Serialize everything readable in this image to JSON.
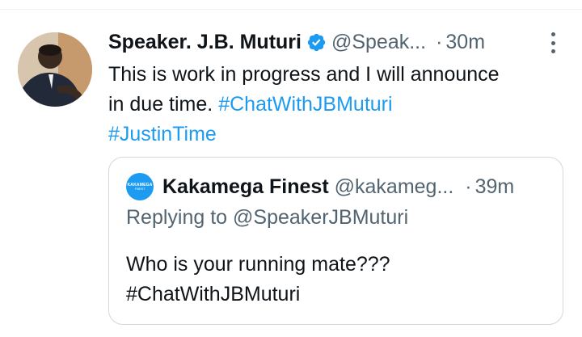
{
  "tweet": {
    "author_name": "Speaker. J.B. Muturi",
    "handle": "@Speak...",
    "separator": "·",
    "time": "30m",
    "text_lines": [
      "This is work in progress and I will announce",
      "in due time."
    ],
    "hashtags": [
      "#ChatWithJBMuturi",
      "#JustinTime"
    ]
  },
  "quoted_tweet": {
    "avatar_text_1": "KAKAMEGA",
    "avatar_text_2": "FINEST",
    "author_name": "Kakamega Finest",
    "handle": "@kakameg...",
    "separator": "·",
    "time": "39m",
    "replying_to": "Replying to @SpeakerJBMuturi",
    "text_line_1": "Who is your running mate???",
    "text_line_2": "#ChatWithJBMuturi"
  },
  "colors": {
    "link": "#1d9bf0",
    "secondary_text": "#536471",
    "primary_text": "#0f1419",
    "border": "#cfd9de"
  },
  "icons": [
    "verified-badge-icon",
    "more-options-icon"
  ]
}
